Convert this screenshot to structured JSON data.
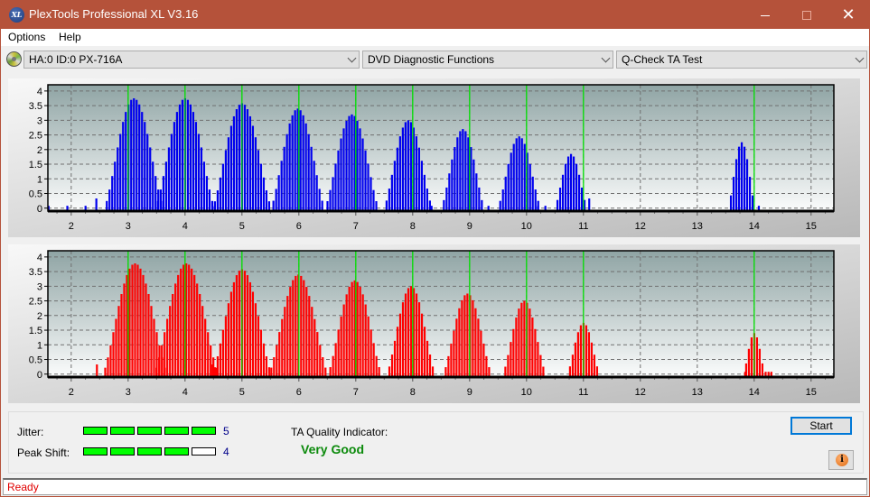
{
  "window": {
    "title": "PlexTools Professional XL V3.16",
    "app_icon_text": "XL",
    "controls": {
      "minimize": "minimize",
      "maximize": "maximize",
      "close": "✕"
    }
  },
  "menu": {
    "items": [
      "Options",
      "Help"
    ]
  },
  "toolbar": {
    "drive": "HA:0 ID:0  PX-716A",
    "function_group": "DVD Diagnostic Functions",
    "test": "Q-Check TA Test"
  },
  "colors": {
    "titlebar": "#b5523a",
    "land_bars": "#0000ee",
    "pit_bars": "#ff0000",
    "reference_lines": "#00ff00",
    "meter_on": "#00ff00",
    "quality_text": "#0b8a0b",
    "status_text": "#e00000"
  },
  "chart_data": [
    {
      "type": "bar",
      "title": "",
      "series_name": "upper (blue)",
      "color": "#0000ee",
      "xlim": [
        1.59,
        15.4
      ],
      "ylim": [
        -0.1,
        4.15
      ],
      "x_ticks": [
        2,
        3,
        4,
        5,
        6,
        7,
        8,
        9,
        10,
        11,
        12,
        13,
        14,
        15
      ],
      "y_ticks": [
        0,
        0.5,
        1,
        1.5,
        2,
        2.5,
        3,
        3.5,
        4
      ],
      "y_tick_labels": [
        "0",
        "0.5",
        "1",
        "1.5",
        "2",
        "2.5",
        "3",
        "3.5",
        "4"
      ],
      "reference_lines_x": [
        3,
        4,
        5,
        6,
        7,
        8,
        9,
        10,
        11,
        14
      ],
      "grid": true,
      "peaks": [
        {
          "center": 3.1,
          "height": 3.75,
          "width": 0.5
        },
        {
          "center": 4.0,
          "height": 3.75,
          "width": 0.5
        },
        {
          "center": 5.0,
          "height": 3.58,
          "width": 0.5
        },
        {
          "center": 5.98,
          "height": 3.4,
          "width": 0.48
        },
        {
          "center": 6.93,
          "height": 3.2,
          "width": 0.46
        },
        {
          "center": 7.92,
          "height": 3.0,
          "width": 0.44
        },
        {
          "center": 8.88,
          "height": 2.7,
          "width": 0.4
        },
        {
          "center": 9.87,
          "height": 2.45,
          "width": 0.38
        },
        {
          "center": 10.78,
          "height": 1.85,
          "width": 0.3
        },
        {
          "center": 13.78,
          "height": 2.25,
          "width": 0.22
        }
      ],
      "extra_bars": [
        [
          1.6,
          0.08
        ],
        [
          1.93,
          0.08
        ],
        [
          2.25,
          0.08
        ],
        [
          2.44,
          0.33
        ],
        [
          4.48,
          0.08
        ],
        [
          8.33,
          0.08
        ],
        [
          9.33,
          0.08
        ],
        [
          10.2,
          0.08
        ],
        [
          10.33,
          0.08
        ],
        [
          11.1,
          0.33
        ],
        [
          14.08,
          0.08
        ]
      ]
    },
    {
      "type": "bar",
      "title": "",
      "series_name": "lower (red)",
      "color": "#ff0000",
      "xlim": [
        1.59,
        15.4
      ],
      "ylim": [
        -0.1,
        4.15
      ],
      "x_ticks": [
        2,
        3,
        4,
        5,
        6,
        7,
        8,
        9,
        10,
        11,
        12,
        13,
        14,
        15
      ],
      "y_ticks": [
        0,
        0.5,
        1,
        1.5,
        2,
        2.5,
        3,
        3.5,
        4
      ],
      "y_tick_labels": [
        "0",
        "0.5",
        "1",
        "1.5",
        "2",
        "2.5",
        "3",
        "3.5",
        "4"
      ],
      "reference_lines_x": [
        3,
        4,
        5,
        6,
        7,
        8,
        9,
        10,
        11,
        14
      ],
      "grid": true,
      "peaks": [
        {
          "center": 3.12,
          "height": 3.78,
          "width": 0.55
        },
        {
          "center": 4.02,
          "height": 3.78,
          "width": 0.55
        },
        {
          "center": 5.0,
          "height": 3.58,
          "width": 0.52
        },
        {
          "center": 5.99,
          "height": 3.4,
          "width": 0.5
        },
        {
          "center": 6.98,
          "height": 3.2,
          "width": 0.48
        },
        {
          "center": 7.97,
          "height": 3.0,
          "width": 0.44
        },
        {
          "center": 8.96,
          "height": 2.75,
          "width": 0.42
        },
        {
          "center": 9.96,
          "height": 2.5,
          "width": 0.4
        },
        {
          "center": 11.0,
          "height": 1.75,
          "width": 0.3
        },
        {
          "center": 14.0,
          "height": 1.4,
          "width": 0.18
        }
      ],
      "extra_bars": [
        [
          2.45,
          0.33
        ],
        [
          4.48,
          0.33
        ],
        [
          13.84,
          0.08
        ],
        [
          14.2,
          0.08
        ],
        [
          14.25,
          0.08
        ],
        [
          14.3,
          0.08
        ]
      ]
    }
  ],
  "results": {
    "jitter_label": "Jitter:",
    "jitter_score": 5,
    "jitter_max": 5,
    "peak_shift_label": "Peak Shift:",
    "peak_shift_score": 4,
    "peak_shift_max": 5,
    "quality_label": "TA Quality Indicator:",
    "quality_value": "Very Good"
  },
  "buttons": {
    "start": "Start",
    "info_icon": "i"
  },
  "status": {
    "text": "Ready"
  }
}
